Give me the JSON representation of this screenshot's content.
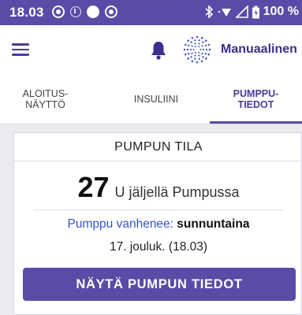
{
  "status_bar": {
    "time": "18.03",
    "battery": "100 %"
  },
  "app_bar": {
    "mode_label": "Manuaalinen"
  },
  "tabs": [
    {
      "label": "ALOITUS-\nNÄYTTÖ",
      "active": false
    },
    {
      "label": "INSULIINI",
      "active": false
    },
    {
      "label": "PUMPPU-\nTIEDOT",
      "active": true
    }
  ],
  "pump_card": {
    "title": "PUMPUN TILA",
    "units_value": "27",
    "units_text": "U jäljellä Pumpussa",
    "expire_label": "Pumppu vanhenee:",
    "expire_day": "sunnuntaina",
    "expire_date": "17. jouluk. (18.03)",
    "button_label": "NÄYTÄ PUMPUN TIEDOT"
  },
  "colors": {
    "accent": "#5b4aa6",
    "accent_dark": "#3a2f8e",
    "link_blue": "#3454c8",
    "background": "#ebebef"
  },
  "icons": [
    "menu-icon",
    "bell-icon",
    "manual-mode-icon",
    "bluetooth-icon",
    "wifi-icon",
    "signal-icon",
    "battery-icon"
  ]
}
